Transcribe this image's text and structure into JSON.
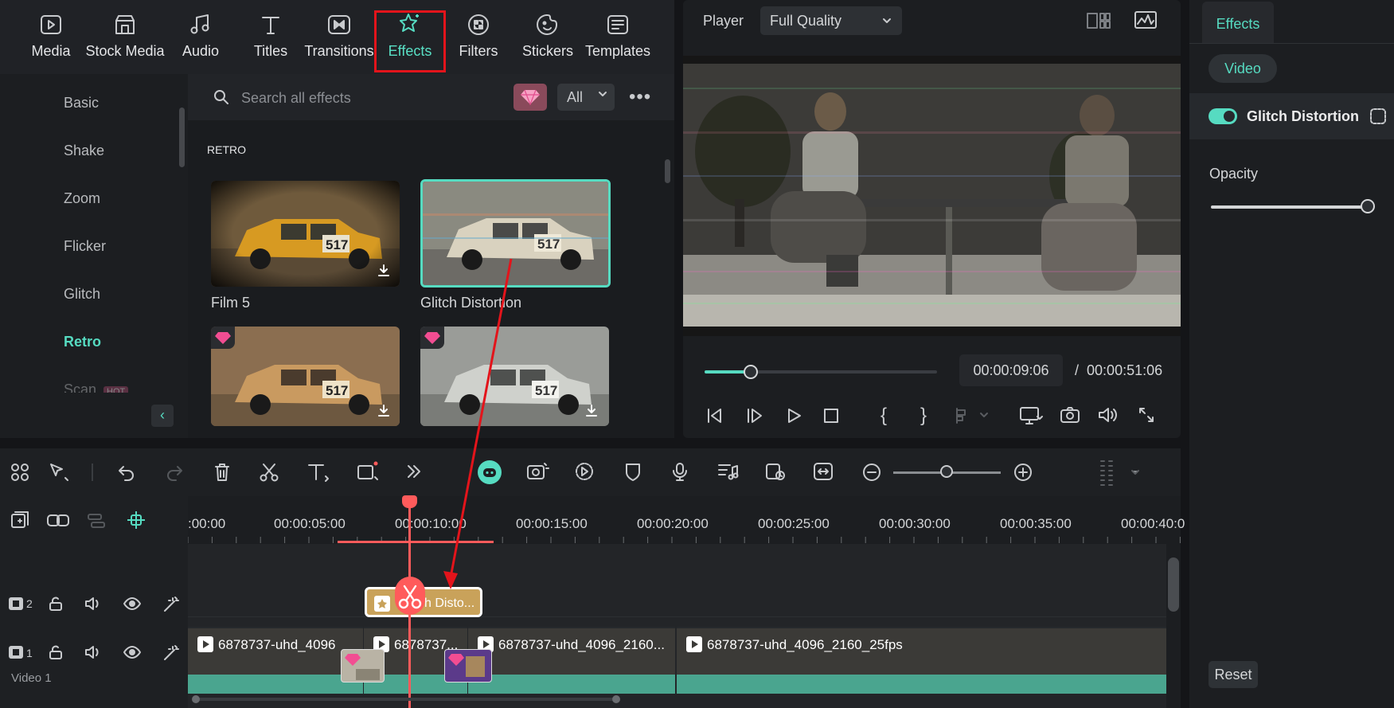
{
  "library": {
    "tabs": [
      {
        "label": "Media",
        "icon": "media-icon"
      },
      {
        "label": "Stock Media",
        "icon": "stock-media-icon"
      },
      {
        "label": "Audio",
        "icon": "audio-icon"
      },
      {
        "label": "Titles",
        "icon": "titles-icon"
      },
      {
        "label": "Transitions",
        "icon": "transitions-icon"
      },
      {
        "label": "Effects",
        "icon": "effects-icon",
        "active": true
      },
      {
        "label": "Filters",
        "icon": "filters-icon"
      },
      {
        "label": "Stickers",
        "icon": "stickers-icon"
      },
      {
        "label": "Templates",
        "icon": "templates-icon"
      }
    ],
    "categories": [
      "Basic",
      "Shake",
      "Zoom",
      "Flicker",
      "Glitch",
      "Retro",
      "Scan"
    ],
    "active_category": "Retro",
    "hot_badge": "HOT",
    "search_placeholder": "Search all effects",
    "filter_value": "All",
    "section_title": "RETRO",
    "effects": [
      {
        "label": "Film 5",
        "selected": false,
        "premium": false
      },
      {
        "label": "Glitch Distortion",
        "selected": true,
        "premium": false
      },
      {
        "label": "",
        "selected": false,
        "premium": true
      },
      {
        "label": "",
        "selected": false,
        "premium": true
      }
    ],
    "thumb_car_number": "517"
  },
  "player": {
    "label": "Player",
    "quality": "Full Quality",
    "current_time": "00:00:09:06",
    "separator": "/",
    "total_time": "00:00:51:06",
    "progress": 0.18
  },
  "properties": {
    "tab": "Effects",
    "sub_tab": "Video",
    "effect_name": "Glitch Distortion",
    "effect_enabled": true,
    "opacity_label": "Opacity",
    "opacity_value": 1.0,
    "reset_label": "Reset"
  },
  "timeline": {
    "ruler_ticks": [
      ":00:00",
      "00:00:05:00",
      "00:00:10:00",
      "00:00:15:00",
      "00:00:20:00",
      "00:00:25:00",
      "00:00:30:00",
      "00:00:35:00",
      "00:00:40:0"
    ],
    "track2_number": "2",
    "track1_number": "1",
    "track1_label": "Video 1",
    "effect_clip_label": "Glitch Disto...",
    "video_clips": [
      {
        "label": "6878737-uhd_4096"
      },
      {
        "label": "6878737..."
      },
      {
        "label": "6878737-uhd_4096_2160..."
      },
      {
        "label": "6878737-uhd_4096_2160_25fps"
      }
    ],
    "zoom_level": 0.45
  },
  "colors": {
    "accent": "#56dbc1",
    "highlight": "#e3141b",
    "playhead": "#ff5b5b",
    "clip_effect": "#c9a25a",
    "clip_video": "#4aa58f"
  }
}
